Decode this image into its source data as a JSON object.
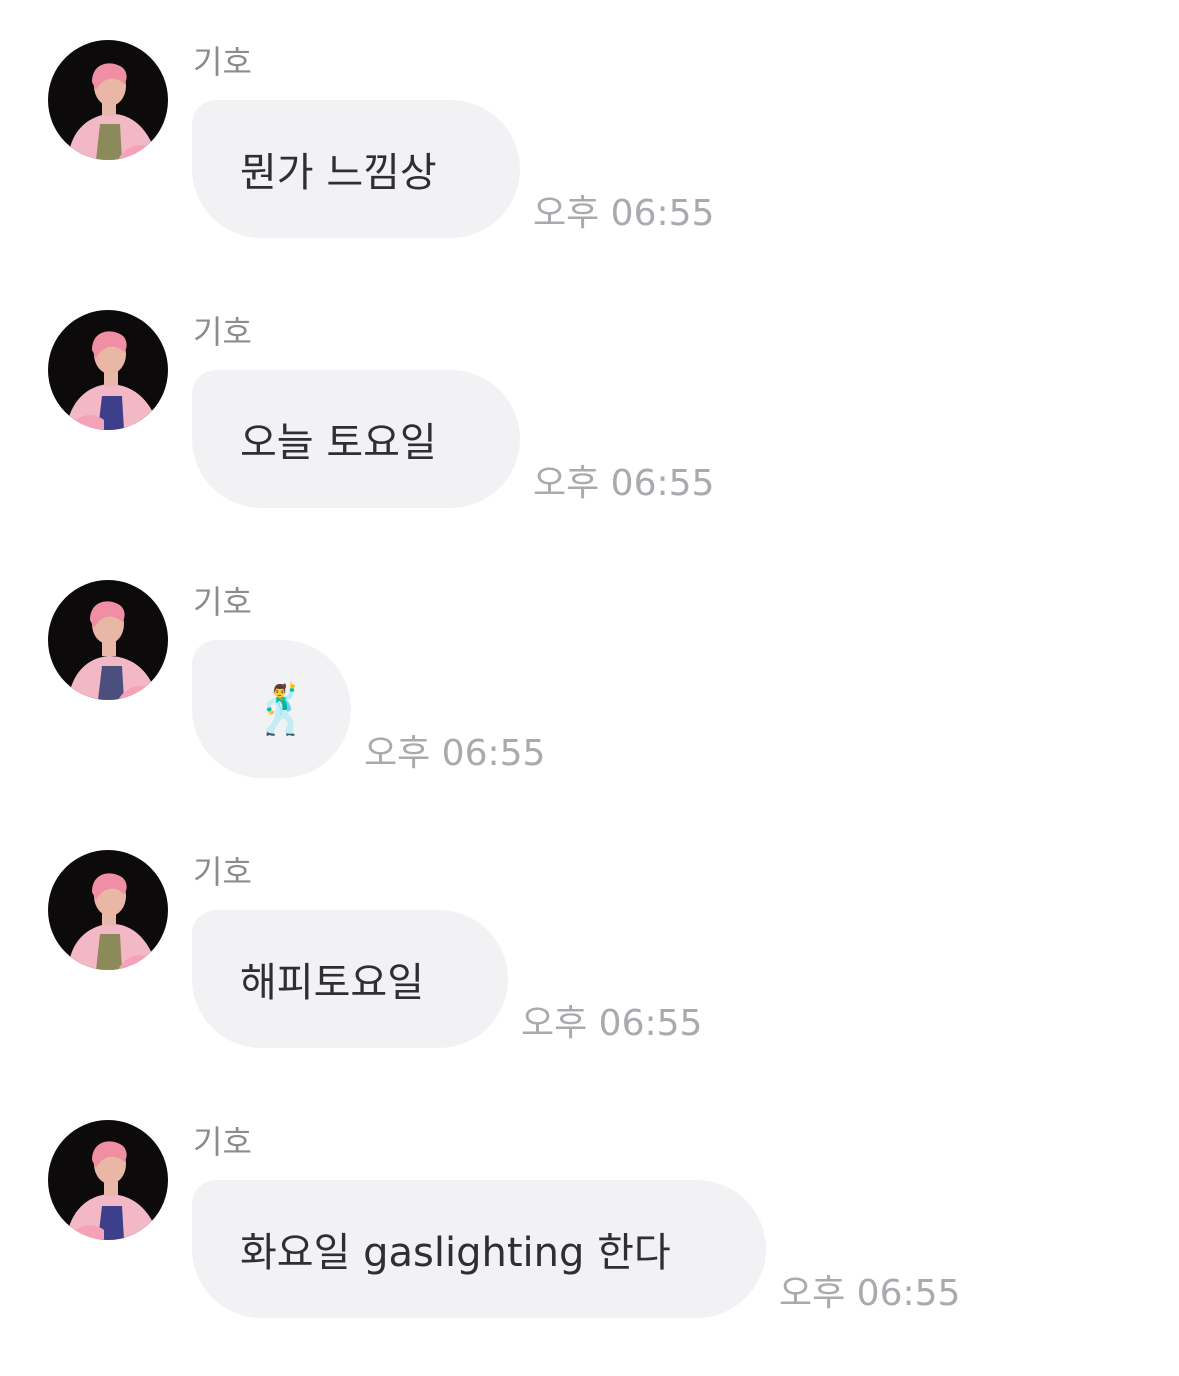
{
  "messages": [
    {
      "sender": "기호",
      "text": "뭔가 느낌상",
      "time": "오후 06:55",
      "avatar_icon": "profile-photo"
    },
    {
      "sender": "기호",
      "text": "오늘 토요일",
      "time": "오후 06:55",
      "avatar_icon": "profile-photo"
    },
    {
      "sender": "기호",
      "text": "🕺",
      "emoji_name": "man-dancing-emoji",
      "time": "오후 06:55",
      "avatar_icon": "profile-photo"
    },
    {
      "sender": "기호",
      "text": "해피토요일",
      "time": "오후 06:55",
      "avatar_icon": "profile-photo"
    },
    {
      "sender": "기호",
      "text": "화요일 gaslighting 한다",
      "time": "오후 06:55",
      "avatar_icon": "profile-photo"
    }
  ],
  "colors": {
    "background": "#ffffff",
    "bubble": "#f2f2f4",
    "message_text": "#2e2e33",
    "sender_text": "#8c8c8c",
    "time_text": "#a9a9ae",
    "avatar_bg": "#0d0a0c",
    "avatar_hair": "#f08fa3",
    "avatar_jacket": "#f3b8c6"
  }
}
